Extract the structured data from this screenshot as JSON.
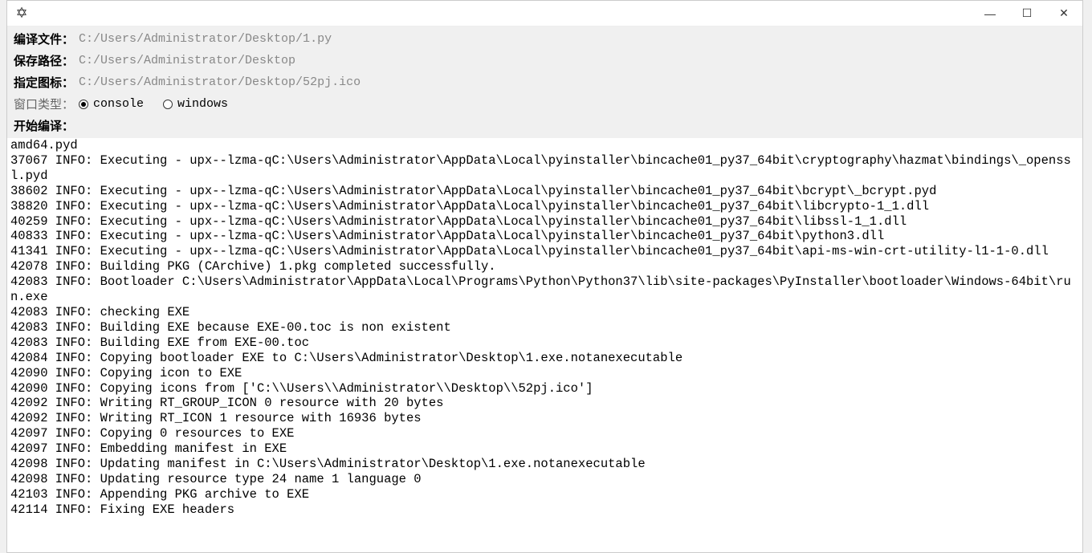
{
  "titlebar": {
    "icon_glyph": "✡",
    "minimize": "—",
    "maximize": "☐",
    "close": "✕"
  },
  "header": {
    "compile_file_label": "编译文件：",
    "compile_file_value": "C:/Users/Administrator/Desktop/1.py",
    "save_path_label": "保存路径：",
    "save_path_value": "C:/Users/Administrator/Desktop",
    "icon_label": "指定图标：",
    "icon_value": "C:/Users/Administrator/Desktop/52pj.ico",
    "window_type_label": "窗口类型：",
    "window_type_options": {
      "console": "console",
      "windows": "windows"
    },
    "start_compile_label": "开始编译："
  },
  "log": "amd64.pyd\n37067 INFO: Executing - upx--lzma-qC:\\Users\\Administrator\\AppData\\Local\\pyinstaller\\bincache01_py37_64bit\\cryptography\\hazmat\\bindings\\_openssl.pyd\n38602 INFO: Executing - upx--lzma-qC:\\Users\\Administrator\\AppData\\Local\\pyinstaller\\bincache01_py37_64bit\\bcrypt\\_bcrypt.pyd\n38820 INFO: Executing - upx--lzma-qC:\\Users\\Administrator\\AppData\\Local\\pyinstaller\\bincache01_py37_64bit\\libcrypto-1_1.dll\n40259 INFO: Executing - upx--lzma-qC:\\Users\\Administrator\\AppData\\Local\\pyinstaller\\bincache01_py37_64bit\\libssl-1_1.dll\n40833 INFO: Executing - upx--lzma-qC:\\Users\\Administrator\\AppData\\Local\\pyinstaller\\bincache01_py37_64bit\\python3.dll\n41341 INFO: Executing - upx--lzma-qC:\\Users\\Administrator\\AppData\\Local\\pyinstaller\\bincache01_py37_64bit\\api-ms-win-crt-utility-l1-1-0.dll\n42078 INFO: Building PKG (CArchive) 1.pkg completed successfully.\n42083 INFO: Bootloader C:\\Users\\Administrator\\AppData\\Local\\Programs\\Python\\Python37\\lib\\site-packages\\PyInstaller\\bootloader\\Windows-64bit\\run.exe\n42083 INFO: checking EXE\n42083 INFO: Building EXE because EXE-00.toc is non existent\n42083 INFO: Building EXE from EXE-00.toc\n42084 INFO: Copying bootloader EXE to C:\\Users\\Administrator\\Desktop\\1.exe.notanexecutable\n42090 INFO: Copying icon to EXE\n42090 INFO: Copying icons from ['C:\\\\Users\\\\Administrator\\\\Desktop\\\\52pj.ico']\n42092 INFO: Writing RT_GROUP_ICON 0 resource with 20 bytes\n42092 INFO: Writing RT_ICON 1 resource with 16936 bytes\n42097 INFO: Copying 0 resources to EXE\n42097 INFO: Embedding manifest in EXE\n42098 INFO: Updating manifest in C:\\Users\\Administrator\\Desktop\\1.exe.notanexecutable\n42098 INFO: Updating resource type 24 name 1 language 0\n42103 INFO: Appending PKG archive to EXE\n42114 INFO: Fixing EXE headers"
}
